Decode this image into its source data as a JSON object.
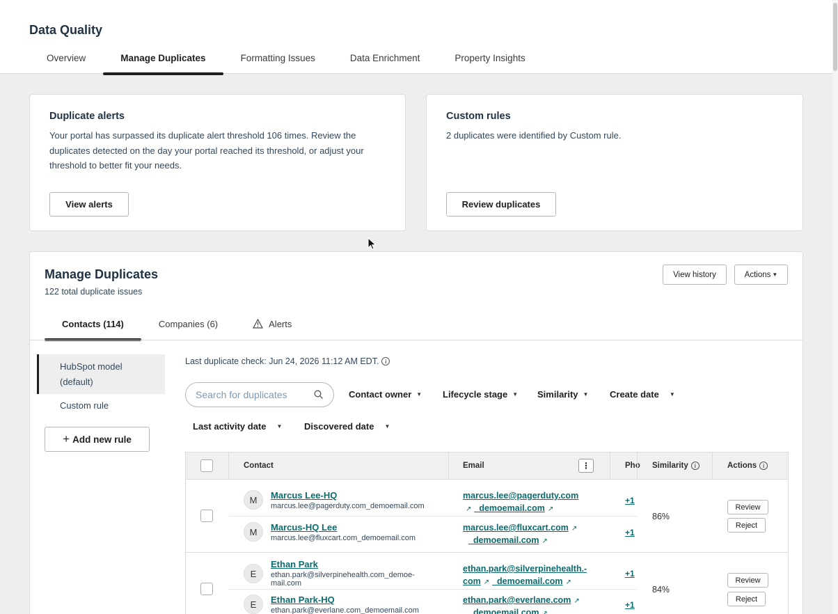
{
  "page": {
    "title": "Data Quality",
    "tabs": [
      "Overview",
      "Manage Duplicates",
      "Formatting Issues",
      "Data Enrichment",
      "Property Insights"
    ],
    "active_tab": "Manage Duplicates"
  },
  "alerts_card": {
    "title": "Duplicate alerts",
    "text": "Your portal has surpassed its duplicate alert threshold 106 times. Review the duplicates detected on the day your portal reached its threshold, or adjust your threshold to better fit your needs.",
    "button": "View alerts"
  },
  "rules_card": {
    "title": "Custom rules",
    "text": "2 duplicates were identified by Custom rule.",
    "button": "Review duplicates"
  },
  "manage": {
    "title": "Manage Duplicates",
    "subtitle": "122 total duplicate issues",
    "view_history": "View history",
    "actions": "Actions",
    "tabs": [
      "Contacts (114)",
      "Companies (6)",
      "Alerts"
    ],
    "rules": [
      "HubSpot model (default)",
      "Custom rule"
    ],
    "add_rule": "Add new rule",
    "last_check": "Last duplicate check: Jun 24, 2026 11:12 AM EDT.",
    "search_placeholder": "Search for duplicates",
    "filters": [
      "Contact owner",
      "Lifecycle stage",
      "Similarity",
      "Create date",
      "Last activity date",
      "Discovered date"
    ]
  },
  "table": {
    "columns": [
      "Contact",
      "Email",
      "Pho",
      "Similarity",
      "Actions"
    ],
    "review": "Review",
    "reject": "Reject",
    "groups": [
      {
        "similarity": "86%",
        "rows": [
          {
            "initial": "M",
            "name": "Marcus Lee-HQ",
            "sub": "marcus.lee@pagerduty.com_demoemail.com",
            "email1": "marcus.lee@pagerduty.com",
            "email2": "_demoemail.com",
            "phone": "+1"
          },
          {
            "initial": "M",
            "name": "Marcus-HQ Lee",
            "sub": "marcus.lee@fluxcart.com_demoemail.com",
            "email1": "marcus.lee@fluxcart.com",
            "email2": "_demoemail.com",
            "phone": "+1"
          }
        ]
      },
      {
        "similarity": "84%",
        "rows": [
          {
            "initial": "E",
            "name": "Ethan Park",
            "sub1": "ethan.park@silverpinehealth.com_demoe-",
            "sub2": "mail.com",
            "email1": "ethan.park@silverpinehealth.-",
            "email2": "com",
            "email3": "_demoemail.com",
            "phone": "+1"
          },
          {
            "initial": "E",
            "name": "Ethan Park-HQ",
            "sub": "ethan.park@everlane.com_demoemail.com",
            "email1": "ethan.park@everlane.com",
            "email2": "_demoemail.com",
            "phone": "+1"
          }
        ]
      }
    ]
  },
  "icons": {
    "external": "external-link-icon",
    "search": "search-icon",
    "info": "info-icon",
    "warning": "warning-icon"
  }
}
